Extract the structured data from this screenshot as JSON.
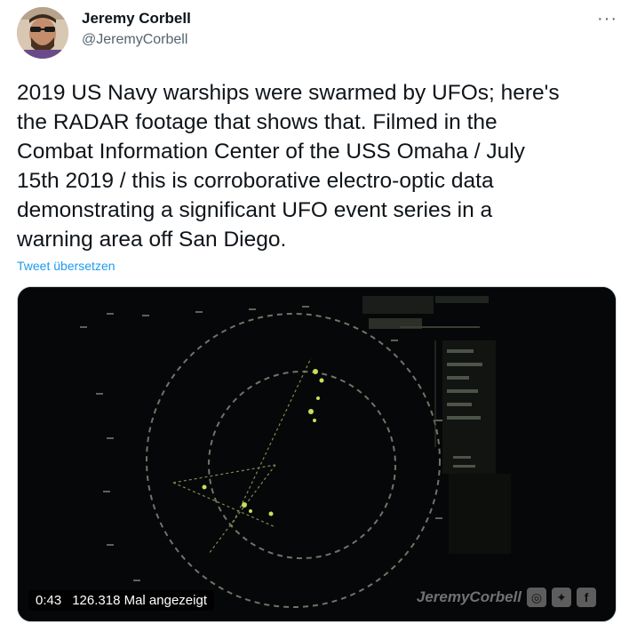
{
  "author": {
    "name": "Jeremy Corbell",
    "handle": "@JeremyCorbell"
  },
  "more_icon": "more-dots-icon",
  "tweet": {
    "text": "2019 US Navy warships were swarmed by UFOs; here's\nthe RADAR footage that shows that. Filmed in the\nCombat Information Center of the USS Omaha / July\n15th 2019 / this is corroborative electro-optic data\ndemonstrating a significant UFO event series in a\nwarning area off San Diego.",
    "translate_label": "Tweet übersetzen"
  },
  "media": {
    "duration": "0:43",
    "views": "126.318 Mal angezeigt",
    "watermark_text": "JeremyCorbell",
    "watermark_icons": [
      "instagram-icon",
      "twitter-icon",
      "facebook-icon"
    ]
  },
  "colors": {
    "link": "#1d9bf0",
    "secondary_text": "#536471",
    "radar_green": "#c6e05a"
  }
}
